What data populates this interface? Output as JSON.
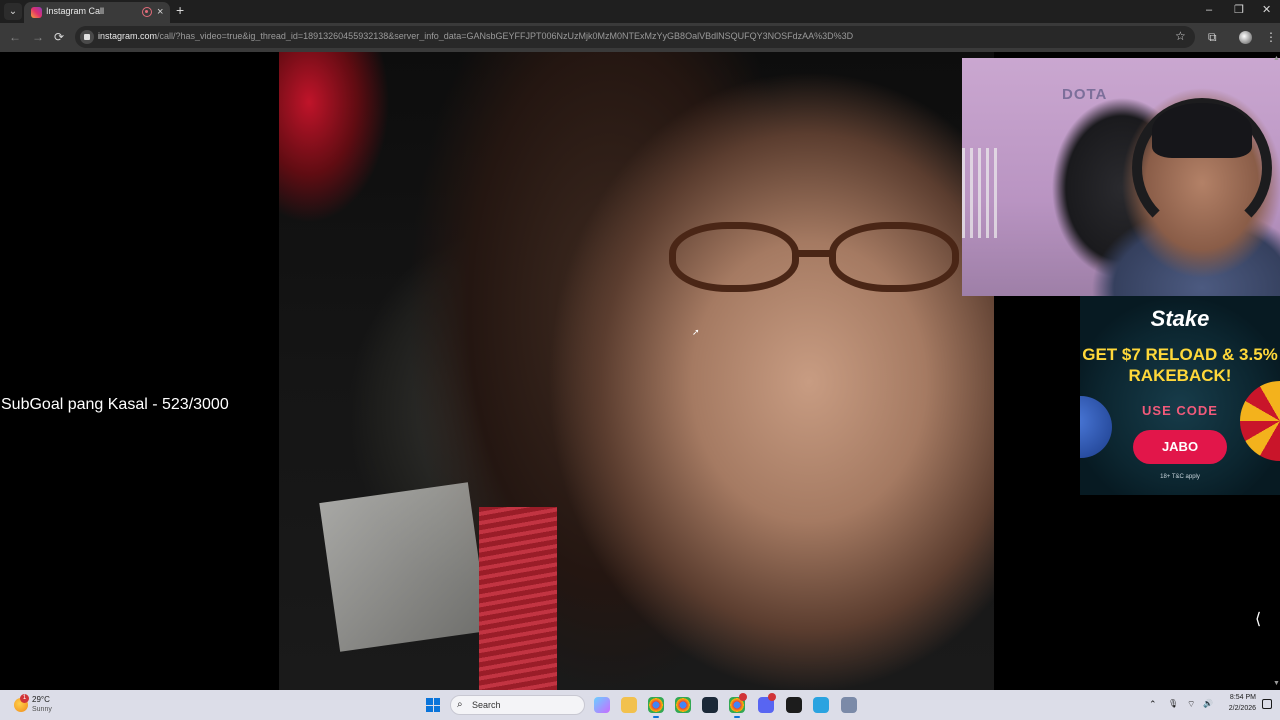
{
  "browser": {
    "tab": {
      "title": "Instagram Call",
      "close": "×"
    },
    "tab_search": "⌄",
    "new_tab": "+",
    "window": {
      "minimize": "–",
      "restore": "❐",
      "close": "✕"
    },
    "nav": {
      "back": "←",
      "forward": "→",
      "reload": "⟳"
    },
    "url": {
      "host": "instagram.com",
      "path": "/call/?has_video=true&ig_thread_id=18913260455932138&server_info_data=GANsbGEYFFJPT006NzUzMjk0MzM0NTExMzYyGB8OalVBdlNSQUFQY3NOSFdzAA%3D%3D"
    },
    "star": "☆",
    "extensions": "⧉",
    "menu": "⋮"
  },
  "page": {
    "subgoal": "SubGoal pang Kasal - 523/3000",
    "webcam_sign": "DOTA",
    "side_chevron": "⟨"
  },
  "ad": {
    "logo": "Stake",
    "headline": "GET $7 RELOAD & 3.5% RAKEBACK!",
    "use_code": "USE CODE",
    "code": "JABO",
    "terms": "18+ T&C apply"
  },
  "taskbar": {
    "weather_temp": "29°C",
    "weather_cond": "Sunny",
    "weather_badge": "1",
    "search_placeholder": "Search",
    "time": "8:54 PM",
    "date": "2/2/2026",
    "tray_chevron": "⌃",
    "mic": "🎙",
    "network": "⌔",
    "volume": "🔊"
  },
  "colors": {
    "accent": "#0a74da",
    "ad_headline": "#ffd83a",
    "ad_button": "#e2164a"
  }
}
